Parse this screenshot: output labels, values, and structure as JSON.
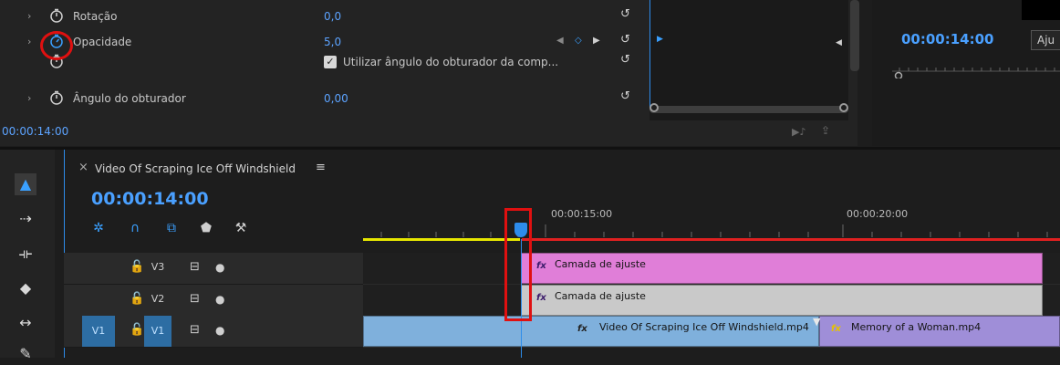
{
  "effect_controls": {
    "rows": [
      {
        "label": "Rotação",
        "value": "0,0",
        "has_chevron": true
      },
      {
        "label": "Opacidade",
        "value": "5,0",
        "has_chevron": true,
        "keyframe_nav": true
      },
      {
        "label": "",
        "checkbox_label": "Utilizar ângulo do obturador da comp...",
        "checked": true
      },
      {
        "label": "Ângulo do obturador",
        "value": "0,00",
        "has_chevron": true
      }
    ],
    "timecode": "00:00:14:00"
  },
  "program_monitor": {
    "timecode": "00:00:14:00",
    "fit_label": "Aju"
  },
  "timeline": {
    "tab_title": "Video Of Scraping Ice Off Windshield",
    "timecode": "00:00:14:00",
    "ruler_labels": [
      "00:00:15:00",
      "00:00:20:00"
    ],
    "tracks": [
      {
        "name": "V3"
      },
      {
        "name": "V2"
      },
      {
        "name": "V1",
        "source_patch": "V1"
      }
    ],
    "clips": {
      "v3": {
        "label": "Camada de ajuste",
        "fx": "fx"
      },
      "v2": {
        "label": "Camada de ajuste",
        "fx": "fx"
      },
      "v1a": {
        "label": "Video Of Scraping Ice Off Windshield.mp4",
        "fx": "fx"
      },
      "v1b": {
        "label": "Memory of a Woman.mp4",
        "fx": "fx"
      }
    }
  },
  "colors": {
    "accent_blue": "#2d8ceb",
    "adjustment_clip": "#e07ed8",
    "video_clip": "#7fb0dc",
    "audio_clip": "#9f8ed8",
    "highlight_red": "#e01010",
    "work_area_yellow": "#e6e600"
  }
}
